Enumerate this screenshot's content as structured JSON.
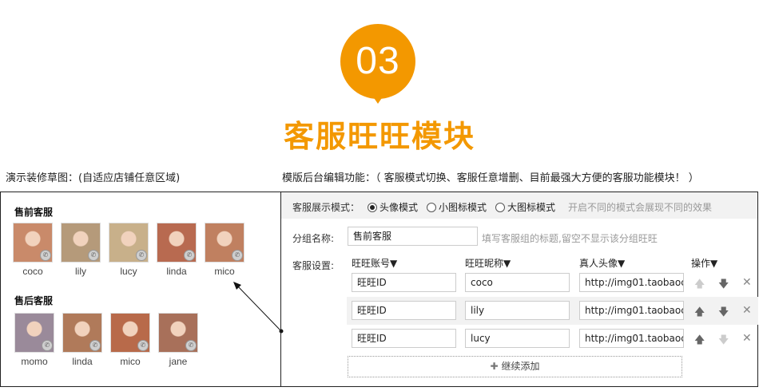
{
  "header": {
    "badge_number": "03",
    "title": "客服旺旺模块",
    "brand_color": "#f39800"
  },
  "captions": {
    "left": "演示装修草图：(自适应店铺任意区域)",
    "right": "模版后台编辑功能：（ 客服模式切换、客服任意增删、目前最强大方便的客服功能模块！ ）"
  },
  "demo": {
    "groups": [
      {
        "title": "售前客服",
        "members": [
          {
            "name": "coco",
            "color": "#c98a6a"
          },
          {
            "name": "lily",
            "color": "#b59a7a"
          },
          {
            "name": "lucy",
            "color": "#c8b08a"
          },
          {
            "name": "linda",
            "color": "#b86a50"
          },
          {
            "name": "mico",
            "color": "#c08060"
          }
        ]
      },
      {
        "title": "售后客服",
        "members": [
          {
            "name": "momo",
            "color": "#9a8a9a"
          },
          {
            "name": "linda",
            "color": "#b07a5a"
          },
          {
            "name": "mico",
            "color": "#b86a4a"
          },
          {
            "name": "jane",
            "color": "#a8705a"
          }
        ]
      }
    ]
  },
  "editor": {
    "mode_label": "客服展示模式：",
    "modes": [
      {
        "label": "头像模式",
        "selected": true
      },
      {
        "label": "小图标模式",
        "selected": false
      },
      {
        "label": "大图标模式",
        "selected": false
      }
    ],
    "mode_hint": "开启不同的模式会展现不同的效果",
    "group_name_label": "分组名称:",
    "group_name_value": "售前客服",
    "group_name_hint": "填写客服组的标题,留空不显示该分组旺旺",
    "settings_label": "客服设置:",
    "columns": [
      "旺旺账号▼",
      "旺旺昵称▼",
      "真人头像▼",
      "操作▼"
    ],
    "rows": [
      {
        "account": "旺旺ID",
        "nickname": "coco",
        "avatar": "http://img01.taobaoc"
      },
      {
        "account": "旺旺ID",
        "nickname": "lily",
        "avatar": "http://img01.taobaoc"
      },
      {
        "account": "旺旺ID",
        "nickname": "lucy",
        "avatar": "http://img01.taobaoc"
      }
    ],
    "add_label": "继续添加"
  }
}
